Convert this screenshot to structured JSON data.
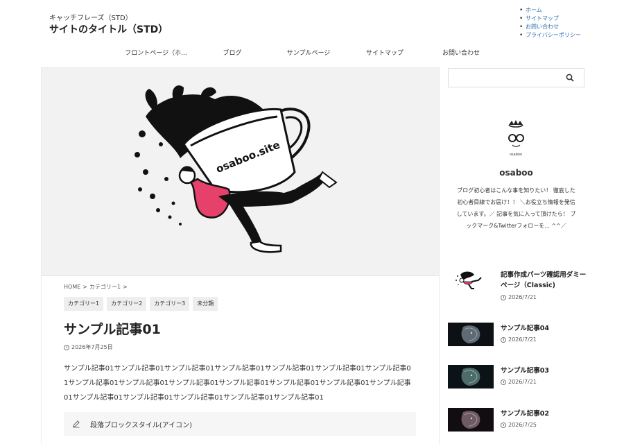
{
  "header": {
    "tagline": "キャッチフレーズ（STD）",
    "site_title": "サイトのタイトル（STD）",
    "util_links": [
      "ホーム",
      "サイトマップ",
      "お問い合わせ",
      "プライバシーポリシー"
    ]
  },
  "global_nav": [
    "フロントページ（ホ...",
    "ブログ",
    "サンプルページ",
    "サイトマップ",
    "お問い合わせ"
  ],
  "eyecatch": {
    "text": "osaboo.site"
  },
  "breadcrumb": {
    "home": "HOME",
    "sep": ">",
    "category": "カテゴリー1",
    "sep2": ">"
  },
  "categories": [
    "カテゴリー1",
    "カテゴリー2",
    "カテゴリー3",
    "未分類"
  ],
  "post": {
    "title": "サンプル記事01",
    "date": "2026年7月25日",
    "body": "サンプル記事01サンプル記事01サンプル記事01サンプル記事01サンプル記事01サンプル記事01サンプル記事01サンプル記事01サンプル記事01サンプル記事01サンプル記事01サンプル記事01サンプル記事01サンプル記事01サンプル記事01サンプル記事01サンプル記事01サンプル記事01サンプル記事01",
    "para_block_label": "段落ブロックスタイル(アイコン)"
  },
  "search": {
    "placeholder": "",
    "icon": "search-icon"
  },
  "profile": {
    "avatar_text": "osaboo",
    "name": "osaboo",
    "bio": "ブログ初心者はこんな事を知りたい！ 徹底した初心者目線でお届け！！ ＼お役立ち情報を発信しています。／ 記事を気に入って頂けたら！ ブックマーク&Twitterフォローを... ^^／"
  },
  "side_posts": [
    {
      "title": "記事作成パーツ確認用ダミーページ（Classic)",
      "date": "2026/7/21"
    },
    {
      "title": "サンプル記事04",
      "date": "2026/7/21"
    },
    {
      "title": "サンプル記事03",
      "date": "2026/7/21"
    },
    {
      "title": "サンプル記事02",
      "date": "2026/7/25"
    }
  ],
  "colors": {
    "link": "#2a6fb2",
    "accent_pink": "#e5416b",
    "tag_bg": "#eeeeee"
  }
}
